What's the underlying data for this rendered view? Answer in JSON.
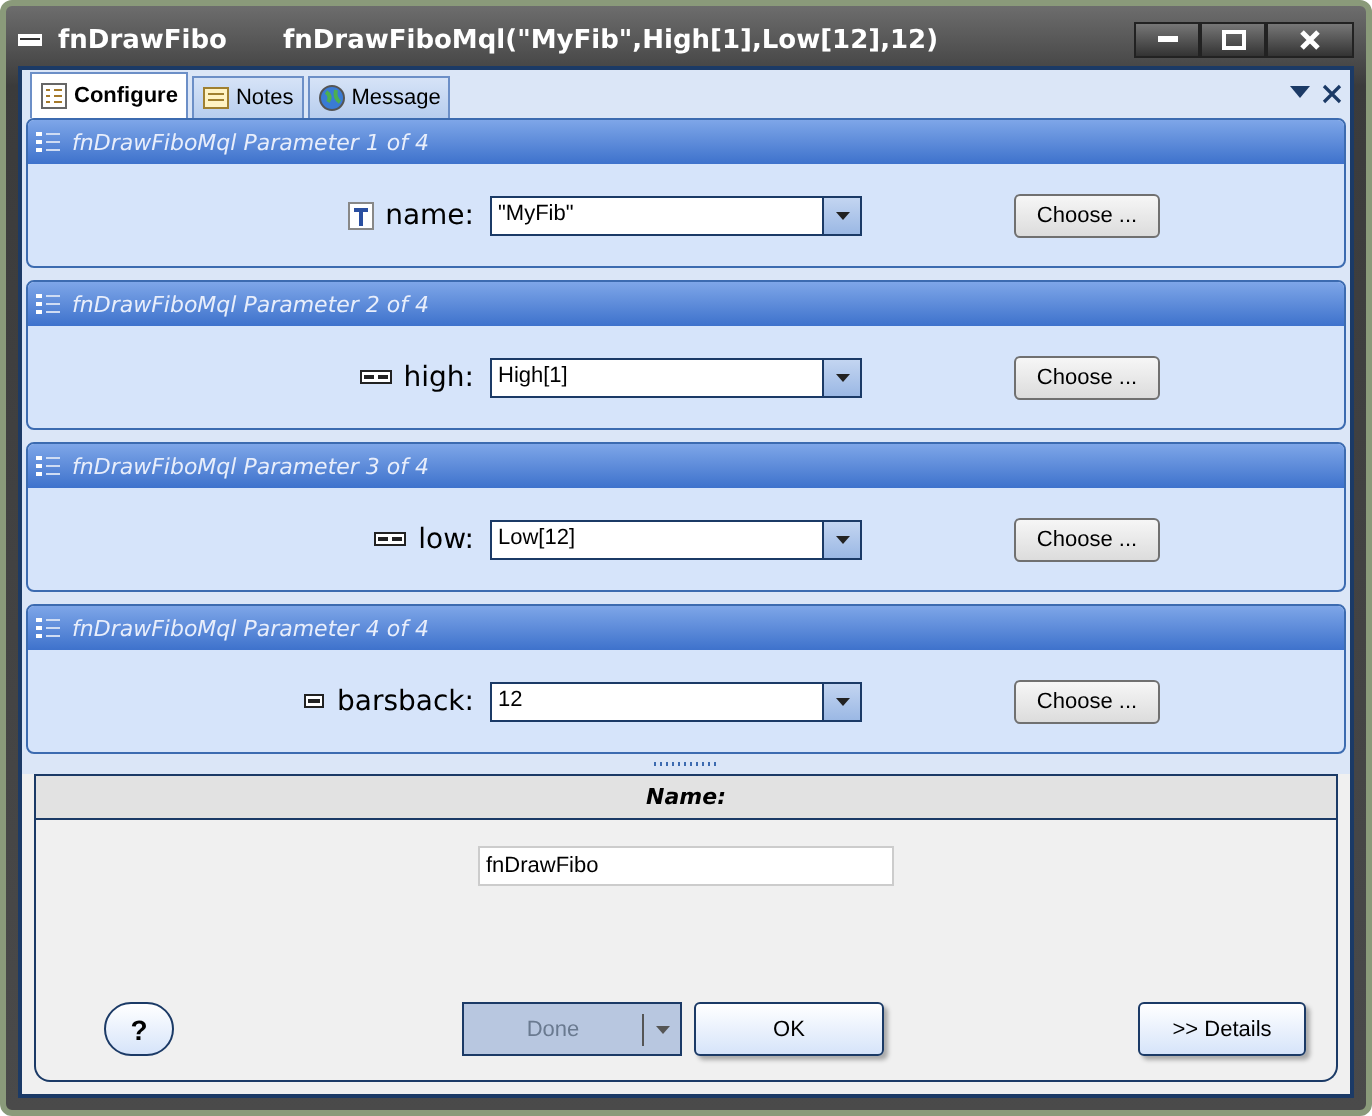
{
  "window": {
    "title": "fnDrawFibo",
    "subtitle": "fnDrawFiboMql(\"MyFib\",High[1],Low[12],12)"
  },
  "tabs": [
    {
      "label": "Configure",
      "selected": true,
      "kind": "configure"
    },
    {
      "label": "Notes",
      "selected": false,
      "kind": "notes"
    },
    {
      "label": "Message",
      "selected": false,
      "kind": "message"
    }
  ],
  "parameters": [
    {
      "header": "fnDrawFiboMql Parameter 1 of 4",
      "kind": "text",
      "label": "name:",
      "value": "\"MyFib\"",
      "button": "Choose ..."
    },
    {
      "header": "fnDrawFiboMql Parameter 2 of 4",
      "kind": "series",
      "label": "high:",
      "value": "High[1]",
      "button": "Choose ..."
    },
    {
      "header": "fnDrawFiboMql Parameter 3 of 4",
      "kind": "series",
      "label": "low:",
      "value": "Low[12]",
      "button": "Choose ..."
    },
    {
      "header": "fnDrawFiboMql Parameter 4 of 4",
      "kind": "number",
      "label": "barsback:",
      "value": "12",
      "button": "Choose ..."
    }
  ],
  "name_section": {
    "heading": "Name:",
    "value": "fnDrawFibo"
  },
  "buttons": {
    "help": "?",
    "done": {
      "label": "Done",
      "disabled": true
    },
    "ok": "OK",
    "details": ">> Details"
  }
}
